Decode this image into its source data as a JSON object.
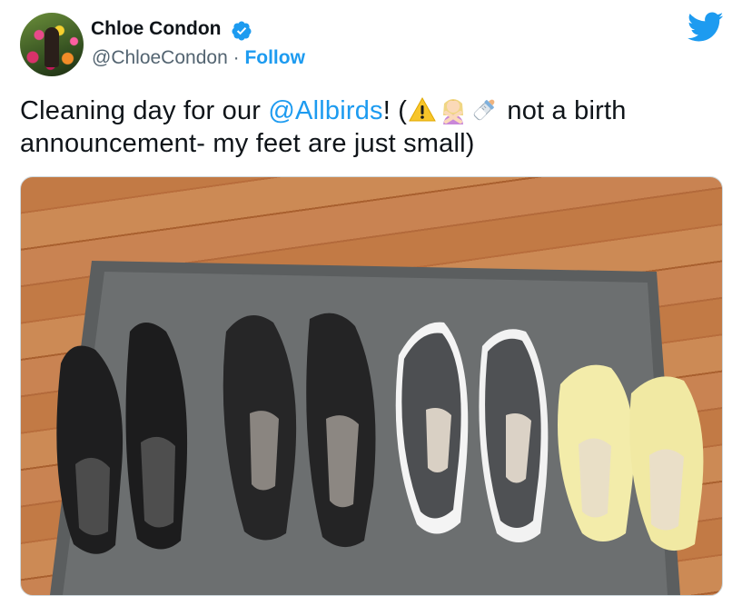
{
  "author": {
    "display_name": "Chloe Condon",
    "handle": "@ChloeCondon",
    "separator": "·",
    "follow_label": "Follow",
    "verified": true
  },
  "tweet": {
    "text_part1": "Cleaning day for our ",
    "mention": "@Allbirds",
    "text_part2": "! (",
    "emojis": [
      "warning-emoji",
      "person-gesturing-no-emoji",
      "baby-bottle-emoji"
    ],
    "text_part3": " not a birth announcement- my feet are just small)"
  },
  "media": {
    "icon": "photo-of-four-pairs-of-shoes"
  },
  "colors": {
    "brand_blue": "#1d9bf0",
    "text": "#0f1419",
    "secondary": "#536471"
  }
}
